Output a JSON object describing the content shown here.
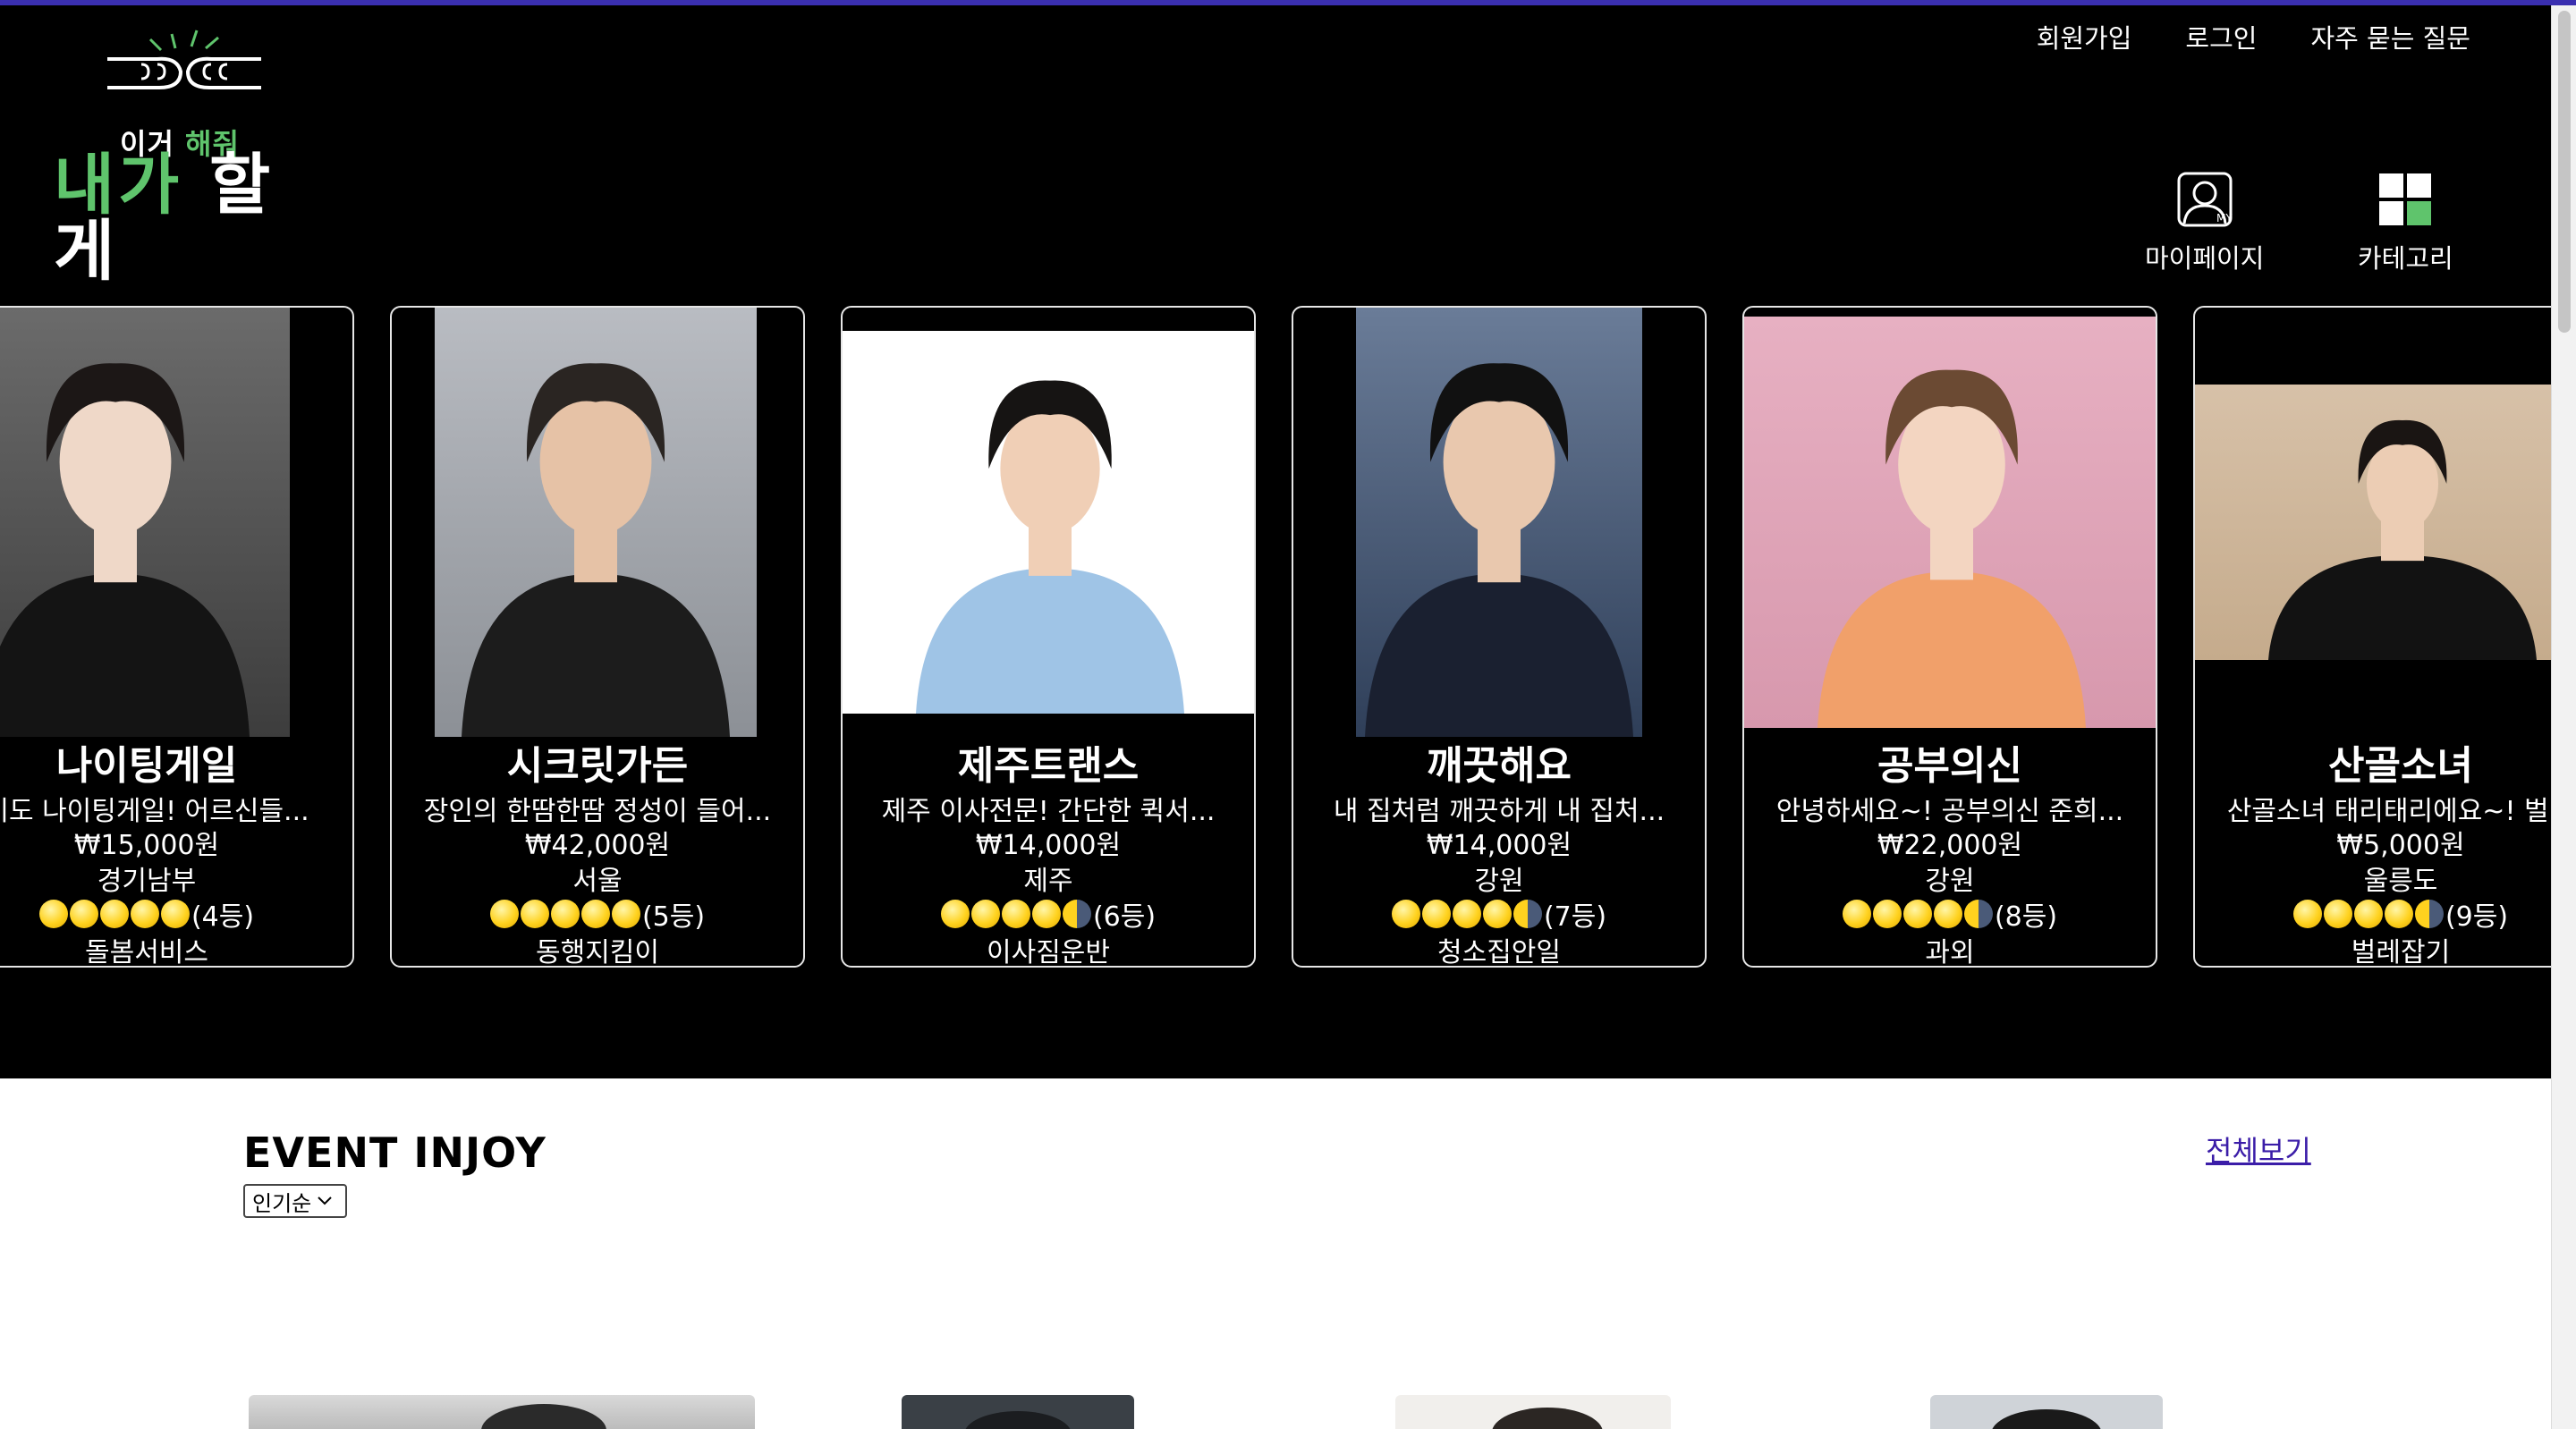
{
  "logo": {
    "line1_prefix": "이거",
    "line1_highlight": "해줘",
    "line2_green": "내가",
    "line2_white": "할게"
  },
  "topnav": {
    "signup": "회원가입",
    "login": "로그인",
    "faq": "자주 묻는 질문"
  },
  "quick": {
    "mypage_label": "마이페이지",
    "category_label": "카테고리",
    "mypage_icon": "my-profile-icon",
    "category_icon": "category-grid-icon"
  },
  "cards": [
    {
      "name": "나이팅게일",
      "desc": "기도 나이팅게일! 어르신들...",
      "price": "₩15,000원",
      "region": "경기남부",
      "rank": "(4등)",
      "category": "돌봄서비스",
      "rating": 5
    },
    {
      "name": "시크릿가든",
      "desc": "장인의 한땀한땀 정성이 들어...",
      "price": "₩42,000원",
      "region": "서울",
      "rank": "(5등)",
      "category": "동행지킴이",
      "rating": 5
    },
    {
      "name": "제주트랜스",
      "desc": "제주 이사전문! 간단한 퀵서...",
      "price": "₩14,000원",
      "region": "제주",
      "rank": "(6등)",
      "category": "이사짐운반",
      "rating": 4.5
    },
    {
      "name": "깨끗해요",
      "desc": "내 집처럼 깨끗하게 내 집처...",
      "price": "₩14,000원",
      "region": "강원",
      "rank": "(7등)",
      "category": "청소집안일",
      "rating": 4.5
    },
    {
      "name": "공부의신",
      "desc": "안녕하세요~! 공부의신 준희...",
      "price": "₩22,000원",
      "region": "강원",
      "rank": "(8등)",
      "category": "과외",
      "rating": 4.5
    },
    {
      "name": "산골소녀",
      "desc": "산골소녀 태리태리에요~! 벌...",
      "price": "₩5,000원",
      "region": "울릉도",
      "rank": "(9등)",
      "category": "벌레잡기",
      "rating": 4.5
    }
  ],
  "event": {
    "title": "EVENT INJOY",
    "sort_selected": "인기순",
    "view_all": "전체보기"
  },
  "colors": {
    "header_bg": "#000000",
    "brand_green": "#5fc46c",
    "link_purple": "#3b1da8",
    "top_line": "#3a2fb0"
  }
}
